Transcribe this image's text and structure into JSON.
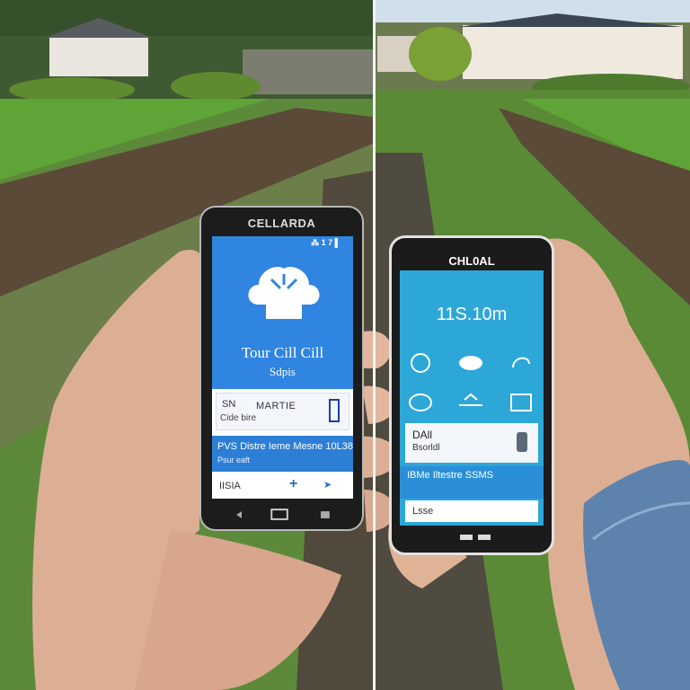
{
  "left_phone": {
    "brand": "CELLARDA",
    "status": "⁂ 1 7 ▌",
    "title": "Tour Cill Cill",
    "subtitle": "Sdpis",
    "row1_a": "SN",
    "row1_b": "MARTIE",
    "row1_c": "Cide bire",
    "band_t1": "PVS Distre Ieme Mesne 10L38",
    "band_t2": "Psur eaft",
    "bottom_label": "IISIA",
    "bottom_plus": "+",
    "bottom_nav": "➤"
  },
  "right_phone": {
    "brand": "CHL0AL",
    "big_text": "11S.10m",
    "row1_a": "DAll",
    "row1_b": "Bsorldl",
    "band_t1": "IBMe Iltestre SSMS",
    "bottom_label": "Lsse"
  },
  "colors": {
    "screen_blue": "#2f85df",
    "screen_cyan": "#2ca7d8",
    "lawn": "#5d8a3a"
  }
}
